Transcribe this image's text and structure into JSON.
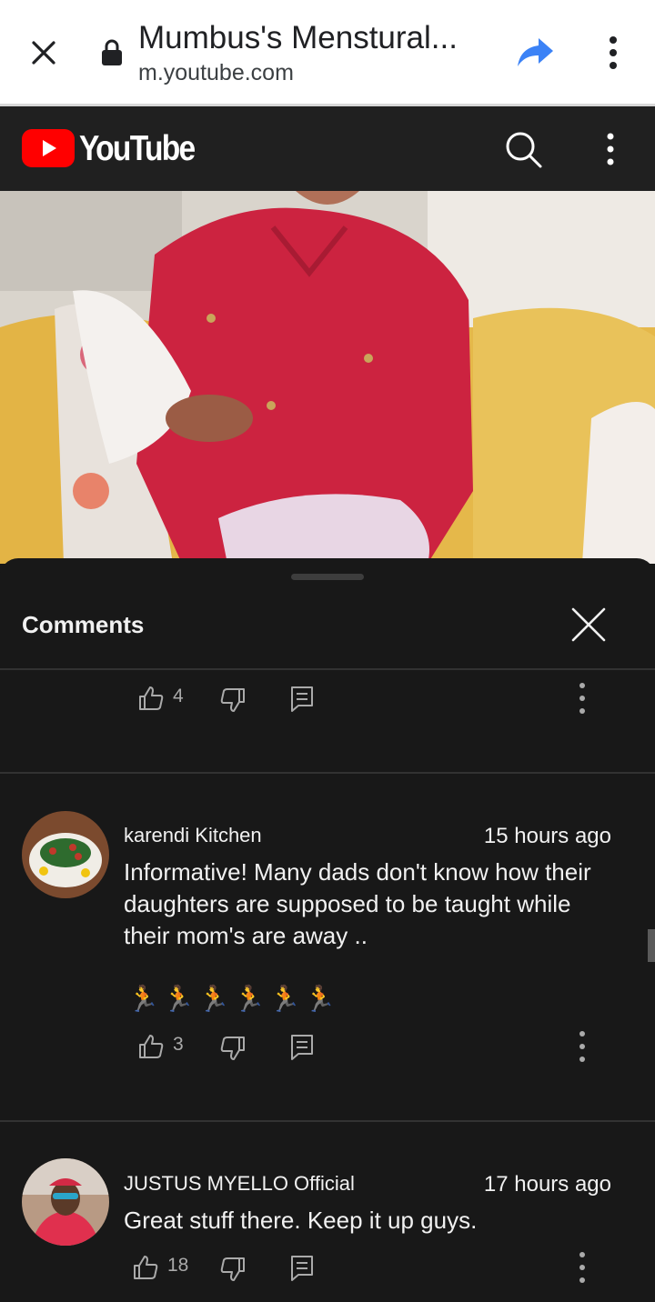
{
  "browser": {
    "page_title": "Mumbus's Menstural...",
    "url": "m.youtube.com"
  },
  "youtube": {
    "logo_text": "YouTube"
  },
  "comments_panel": {
    "title": "Comments",
    "previous_comment": {
      "likes": "4"
    },
    "items": [
      {
        "author": "karendi Kitchen",
        "time": "15 hours ago",
        "text": "Informative! Many dads don't know how their daughters are supposed to be taught while their mom's are away ..",
        "emojis": "🏃🏃🏃🏃🏃🏃",
        "likes": "3"
      },
      {
        "author": "JUSTUS MYELLO Official",
        "time": "17 hours ago",
        "text": "Great stuff there. Keep it up guys.",
        "likes": "18"
      }
    ]
  },
  "colors": {
    "youtube_red": "#ff0000",
    "share_blue": "#3b82f6",
    "dark_bg": "#181818",
    "header_bg": "#202020"
  },
  "icons": [
    "close-icon",
    "lock-icon",
    "share-icon",
    "more-vert-icon",
    "search-icon",
    "thumbs-up-icon",
    "thumbs-down-icon",
    "reply-icon"
  ]
}
